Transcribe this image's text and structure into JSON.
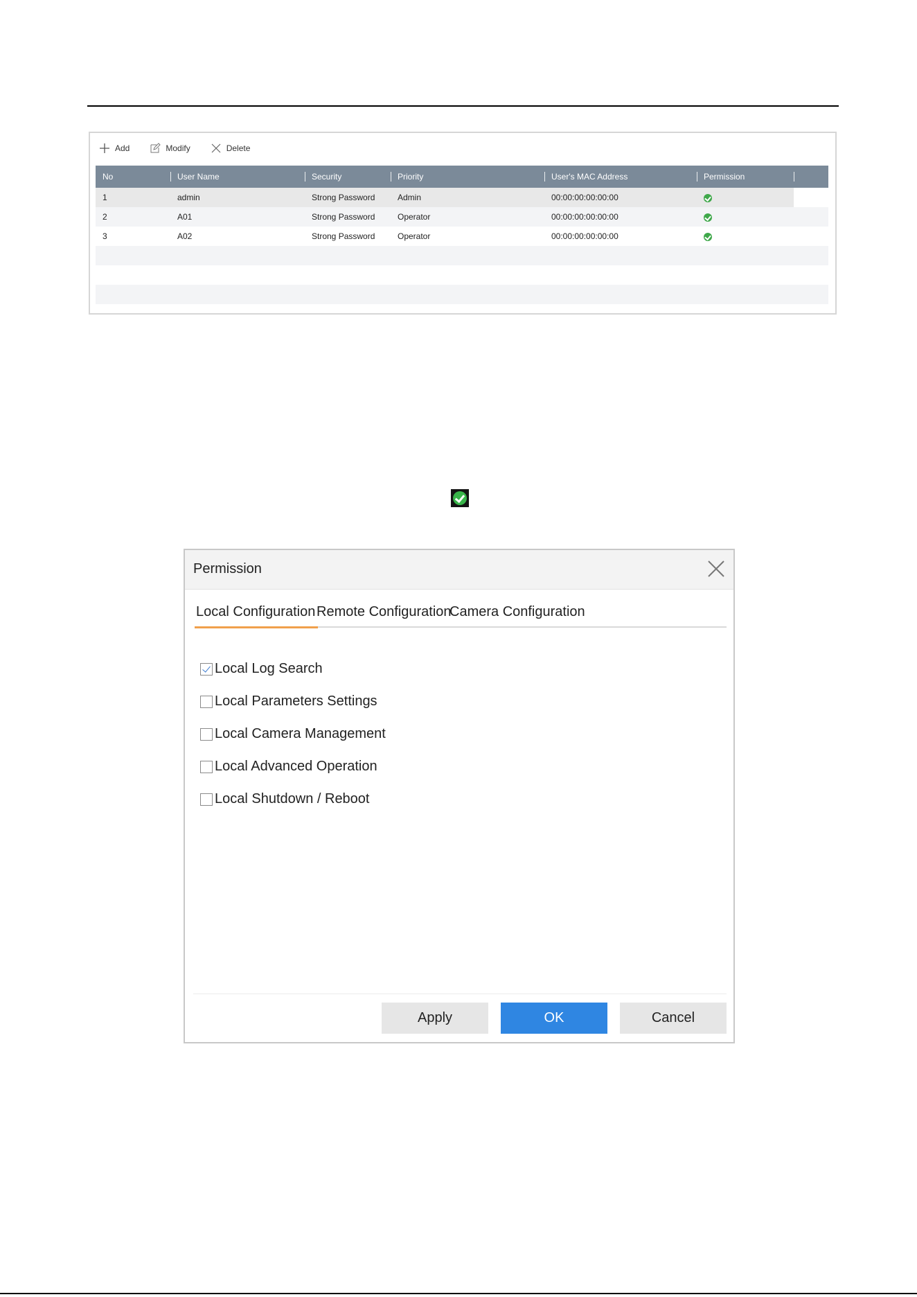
{
  "toolbar": {
    "add_label": "Add",
    "modify_label": "Modify",
    "delete_label": "Delete"
  },
  "user_table": {
    "columns": [
      "No",
      "User Name",
      "Security",
      "Priority",
      "User's MAC Address",
      "Permission"
    ],
    "rows": [
      {
        "no": "1",
        "user_name": "admin",
        "security": "Strong Password",
        "priority": "Admin",
        "mac": "00:00:00:00:00:00",
        "permission": "check-icon"
      },
      {
        "no": "2",
        "user_name": "A01",
        "security": "Strong Password",
        "priority": "Operator",
        "mac": "00:00:00:00:00:00",
        "permission": "check-icon"
      },
      {
        "no": "3",
        "user_name": "A02",
        "security": "Strong Password",
        "priority": "Operator",
        "mac": "00:00:00:00:00:00",
        "permission": "check-icon"
      }
    ]
  },
  "dialog": {
    "title": "Permission",
    "tabs": [
      {
        "label": "Local Configuration",
        "active": true
      },
      {
        "label": "Remote Configuration",
        "active": false
      },
      {
        "label": "Camera Configuration",
        "active": false
      }
    ],
    "permissions": [
      {
        "label": "Local Log Search",
        "checked": true
      },
      {
        "label": "Local Parameters Settings",
        "checked": false
      },
      {
        "label": "Local Camera Management",
        "checked": false
      },
      {
        "label": "Local Advanced Operation",
        "checked": false
      },
      {
        "label": "Local Shutdown / Reboot",
        "checked": false
      }
    ],
    "apply_label": "Apply",
    "ok_label": "OK",
    "cancel_label": "Cancel"
  },
  "colors": {
    "table_header": "#7b8a99",
    "ok_button": "#2f86e2",
    "tab_accent": "#f0a04b",
    "check_green": "#3fa84a"
  }
}
